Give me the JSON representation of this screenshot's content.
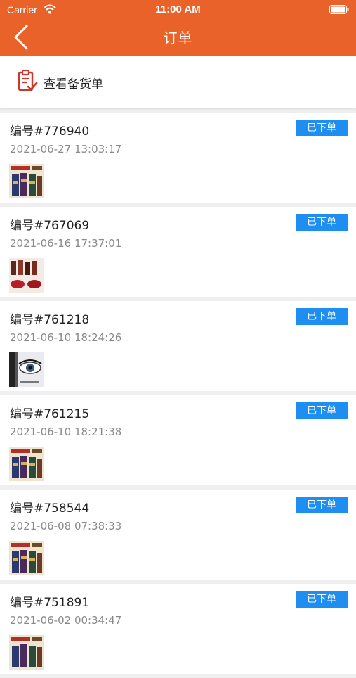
{
  "status_bar": {
    "carrier": "Carrier",
    "time": "11:00 AM"
  },
  "nav": {
    "title": "订单"
  },
  "prep": {
    "label": "查看备货单"
  },
  "orders": [
    {
      "number": "编号#776940",
      "date": "2021-06-27 13:03:17",
      "status": "已下单",
      "thumb": "tea-box"
    },
    {
      "number": "编号#767069",
      "date": "2021-06-16 17:37:01",
      "status": "已下单",
      "thumb": "lipstick"
    },
    {
      "number": "编号#761218",
      "date": "2021-06-10 18:24:26",
      "status": "已下单",
      "thumb": "eyelash"
    },
    {
      "number": "编号#761215",
      "date": "2021-06-10 18:21:38",
      "status": "已下单",
      "thumb": "tea-box"
    },
    {
      "number": "编号#758544",
      "date": "2021-06-08 07:38:33",
      "status": "已下单",
      "thumb": "tea-box"
    },
    {
      "number": "编号#751891",
      "date": "2021-06-02 00:34:47",
      "status": "已下单",
      "thumb": "tea-box"
    }
  ],
  "colors": {
    "header": "#e8622a",
    "badge": "#1e8ef0",
    "background": "#efefef"
  }
}
